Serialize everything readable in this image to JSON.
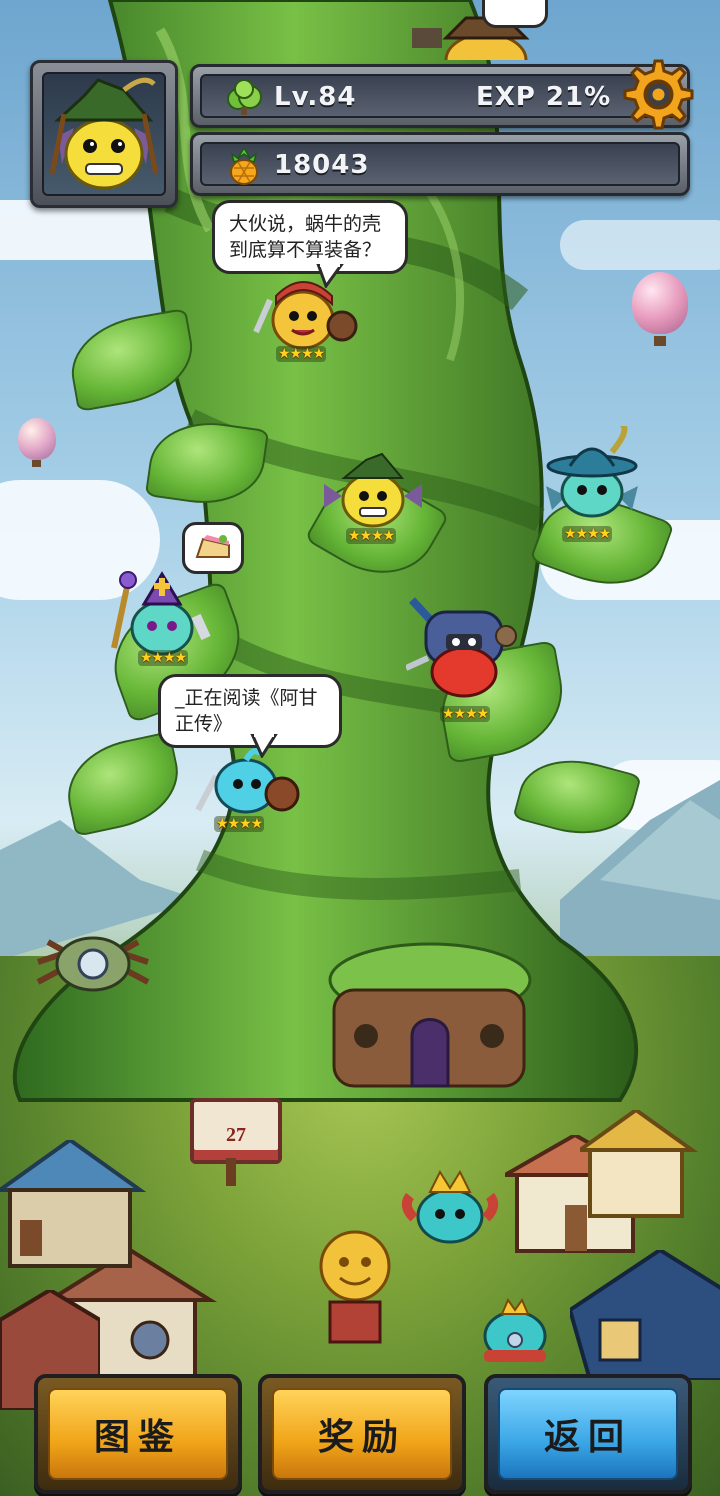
{
  "hud": {
    "level_label": "Lv.84",
    "exp_label": "EXP 21%",
    "coins": "18043",
    "icons": {
      "level": "bush-icon",
      "coins": "pineapple-coin-icon",
      "settings": "gear-icon"
    }
  },
  "bubbles": {
    "top": "大伙说，蜗牛的壳到底算不算装备？",
    "reading": "_正在阅读《阿甘正传》",
    "food_icon": "cake-slice-icon"
  },
  "heroes": [
    {
      "name": "knight-chick",
      "stars": "★★★★"
    },
    {
      "name": "witch-lemon",
      "stars": "★★★★"
    },
    {
      "name": "feather-hat-slime",
      "stars": "★★★★"
    },
    {
      "name": "bishop-slime",
      "stars": "★★★★"
    },
    {
      "name": "armored-red-slime",
      "stars": "★★★★"
    },
    {
      "name": "blue-slime-shield",
      "stars": "★★★★"
    }
  ],
  "signpost": "27",
  "buttons": {
    "collection": "图鉴",
    "rewards": "奖励",
    "back": "返回"
  },
  "colors": {
    "gold_button": "#f0a418",
    "blue_button": "#3aa6e6",
    "star": "#ffd21c"
  }
}
